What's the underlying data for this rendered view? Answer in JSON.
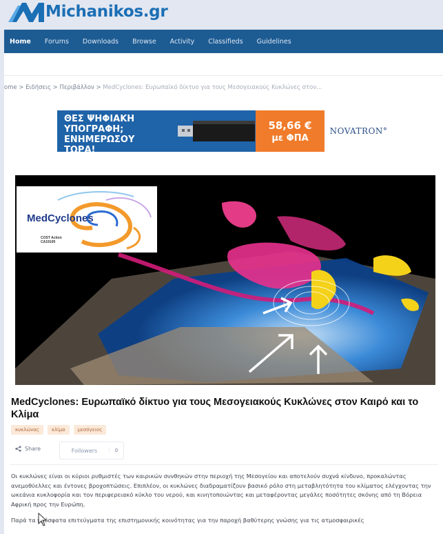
{
  "site": {
    "name": "Michanikos.gr"
  },
  "nav": {
    "items": [
      {
        "label": "Home",
        "active": true
      },
      {
        "label": "Forums"
      },
      {
        "label": "Downloads"
      },
      {
        "label": "Browse"
      },
      {
        "label": "Activity"
      },
      {
        "label": "Classifieds"
      },
      {
        "label": "Guidelines"
      }
    ]
  },
  "breadcrumb": {
    "items": [
      "ome",
      "Ειδήσεις",
      "Περιβάλλον"
    ],
    "separator": ">",
    "current": "MedCyclones: Ευρωπαϊκό δίκτυο για τους Μεσογειακούς Κυκλώνες στον..."
  },
  "ad": {
    "line1": "ΘΕΣ ΨΗΦΙΑΚΗ",
    "line2": "ΥΠΟΓΡΑΦΗ;",
    "line3": "ΕΝΗΜΕΡΩΣΟΥ ΤΩΡΑ!",
    "price": "58,66 €",
    "price_note": "με ΦΠΑ",
    "brand": "NOVATRON°"
  },
  "hero": {
    "logo_text": "MedCyclones",
    "logo_sub1": "COST Action",
    "logo_sub2": "CA19109"
  },
  "article": {
    "title": "MedCyclones: Ευρωπαϊκό δίκτυο για τους Μεσογειακούς Κυκλώνες στον Καιρό και το Κλίμα",
    "tags": [
      "κυκλώνας",
      "κλίμα",
      "μεσόγειος"
    ],
    "share_label": "Share",
    "followers_label": "Followers",
    "followers_count": "0",
    "paragraph1": "Οι κυκλώνες είναι οι κύριοι ρυθμιστές των καιρικών συνθηκών στην περιοχή της Μεσογείου και αποτελούν συχνά κίνδυνο, προκαλώντας ανεμοθύελλες και έντονες βροχοπτώσεις. Επιπλέον, οι κυκλώνες διαδραματίζουν βασικό ρόλο στη μεταβλητότητα του κλίματος ελέγχοντας την ωκεάνια κυκλοφορία και τον περιφερειακό κύκλο του νερού, και κινητοποιώντας και μεταφέροντας μεγάλες ποσότητες σκόνης από τη Βόρεια Αφρική προς την Ευρώπη.",
    "paragraph2": "Παρά τα πρόσφατα επιτεύγματα της επιστημονικής κοινότητας για την παροχή βαθύτερης γνώσης για τις ατμοσφαιρικές"
  },
  "colors": {
    "nav_bg": "#1d5b93",
    "logo_blue": "#1b6fb5",
    "ad_blue": "#1f63a8",
    "ad_orange": "#f07b2a",
    "tag_bg": "#fbe9d9"
  }
}
